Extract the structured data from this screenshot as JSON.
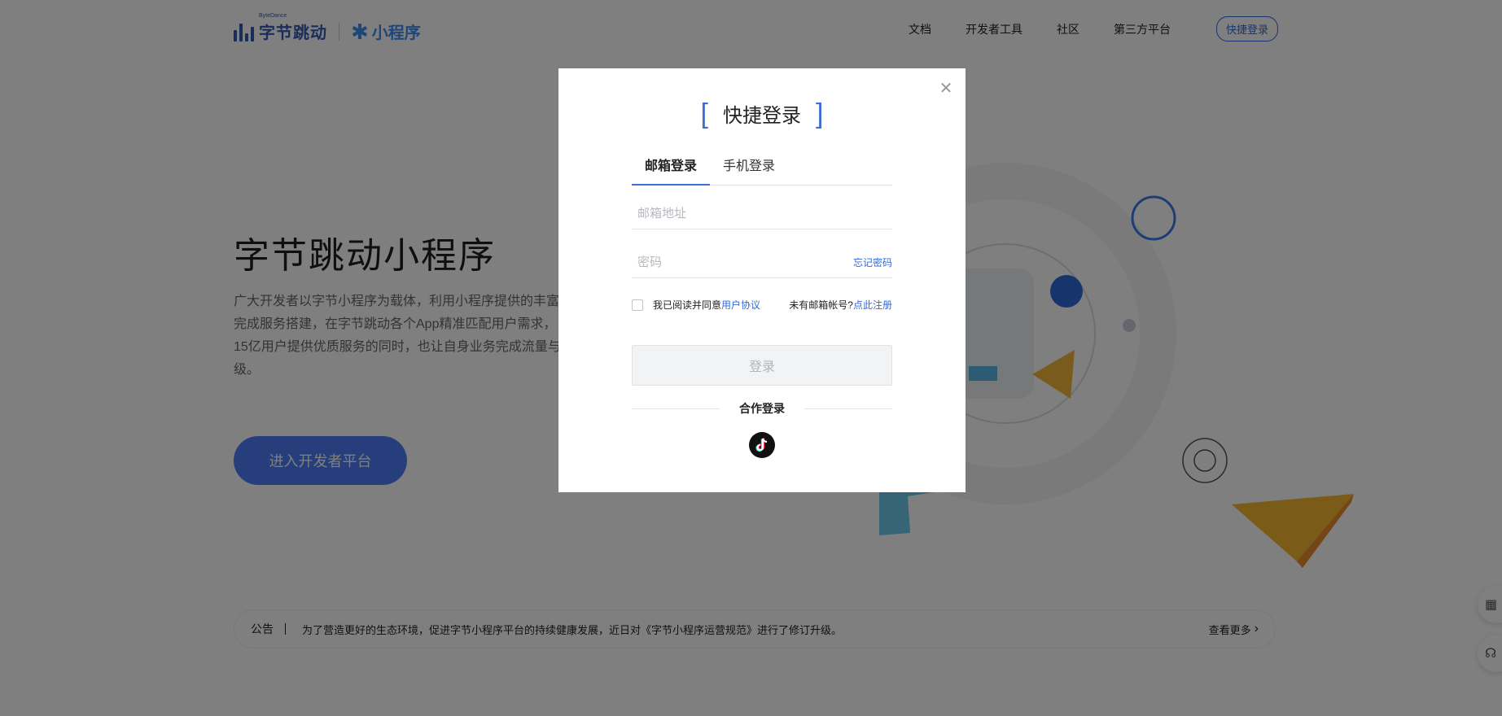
{
  "header": {
    "logo_small": "ByteDance",
    "logo_brand": "字节跳动",
    "logo_product": "小程序",
    "nav": [
      "文档",
      "开发者工具",
      "社区",
      "第三方平台"
    ],
    "quick_login": "快捷登录"
  },
  "hero": {
    "title": "字节跳动小程序",
    "desc_lines": [
      "广大开发者以字节小程序为载体，利用小程序提供的丰富",
      "完成服务搭建，在字节跳动各个App精准匹配用户需求，",
      "15亿用户提供优质服务的同时，也让自身业务完成流量与",
      "级。"
    ],
    "enter_button": "进入开发者平台"
  },
  "notice": {
    "label": "公告",
    "text": "为了营造更好的生态环境，促进字节小程序平台的持续健康发展，近日对《字节小程序运营规范》进行了修订升级。",
    "more": "查看更多"
  },
  "modal": {
    "title": "快捷登录",
    "tabs": [
      "邮箱登录",
      "手机登录"
    ],
    "email_placeholder": "邮箱地址",
    "password_placeholder": "密码",
    "forgot": "忘记密码",
    "agree_prefix": "我已阅读并同意",
    "agree_link": "用户协议",
    "no_account": "未有邮箱帐号?",
    "register": "点此注册",
    "login_button": "登录",
    "coop_title": "合作登录",
    "coop_icons": [
      "tiktok-icon"
    ]
  },
  "colors": {
    "accent": "#3a6fd8",
    "primary_button": "#4d7cf6",
    "overlay": "rgba(0,0,0,0.5)"
  }
}
